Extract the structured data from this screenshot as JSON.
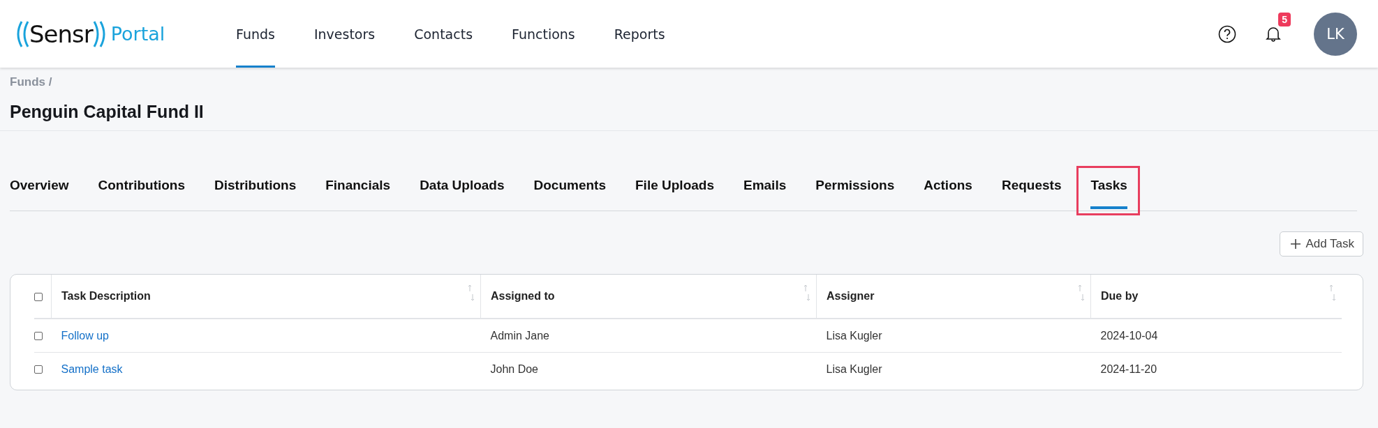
{
  "header": {
    "logo": {
      "name": "Sensr",
      "suffix": "Portal"
    },
    "nav": [
      {
        "label": "Funds",
        "selected": true
      },
      {
        "label": "Investors",
        "selected": false
      },
      {
        "label": "Contacts",
        "selected": false
      },
      {
        "label": "Functions",
        "selected": false
      },
      {
        "label": "Reports",
        "selected": false
      }
    ],
    "notifications": {
      "count": "5"
    },
    "avatar": {
      "initials": "LK"
    }
  },
  "breadcrumb": [
    "Funds /"
  ],
  "title": "Penguin Capital Fund II",
  "tabs": [
    {
      "label": "Overview",
      "selected": false,
      "highlighted": false
    },
    {
      "label": "Contributions",
      "selected": false,
      "highlighted": false
    },
    {
      "label": "Distributions",
      "selected": false,
      "highlighted": false
    },
    {
      "label": "Financials",
      "selected": false,
      "highlighted": false
    },
    {
      "label": "Data Uploads",
      "selected": false,
      "highlighted": false
    },
    {
      "label": "Documents",
      "selected": false,
      "highlighted": false
    },
    {
      "label": "File Uploads",
      "selected": false,
      "highlighted": false
    },
    {
      "label": "Emails",
      "selected": false,
      "highlighted": false
    },
    {
      "label": "Permissions",
      "selected": false,
      "highlighted": false
    },
    {
      "label": "Actions",
      "selected": false,
      "highlighted": false
    },
    {
      "label": "Requests",
      "selected": false,
      "highlighted": false
    },
    {
      "label": "Tasks",
      "selected": true,
      "highlighted": true
    }
  ],
  "add_button": {
    "label": "Add Task"
  },
  "table": {
    "select_all": {
      "checked": false
    },
    "columns": [
      "Task Description",
      "Assigned to",
      "Assigner",
      "Due by"
    ],
    "rows": [
      {
        "checked": false,
        "cells": [
          "Follow up",
          "Admin Jane",
          "Lisa Kugler",
          "2024-10-04"
        ]
      },
      {
        "checked": false,
        "cells": [
          "Sample task",
          "John Doe",
          "Lisa Kugler",
          "2024-11-20"
        ]
      }
    ]
  }
}
